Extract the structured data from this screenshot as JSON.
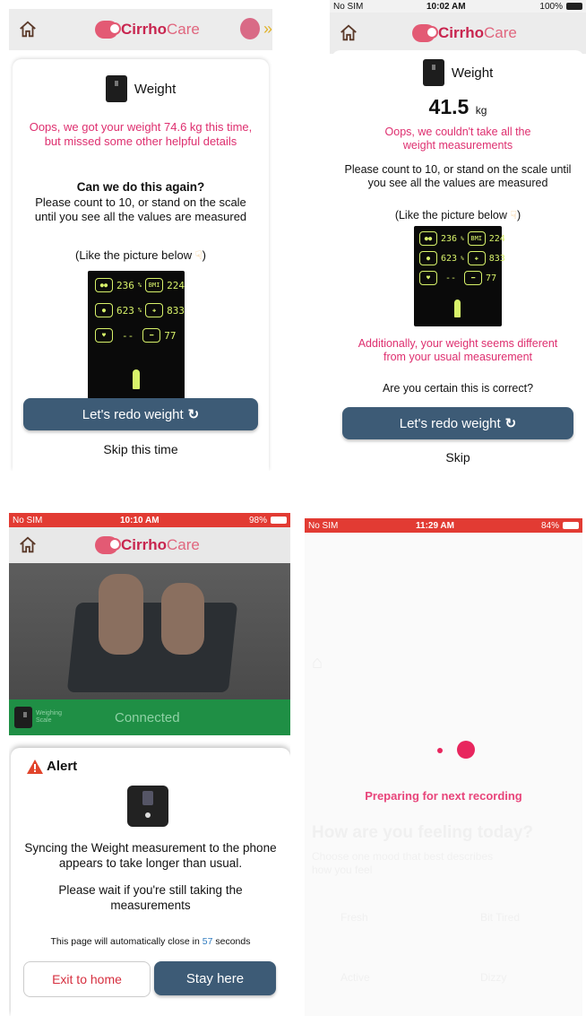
{
  "panel1": {
    "logo_bold": "Cirrho",
    "logo_light": "Care",
    "title": "Weight",
    "warning": "Oops, we got your weight 74.6 kg this time, but missed some other helpful details",
    "question": "Can we do this again?",
    "instruction": "Please count to 10, or stand on the scale until you see all the values are measured",
    "picture_hint": "(Like the picture below",
    "picture_hint_end": ")",
    "display": {
      "r1a": "236",
      "r1a_unit": "%",
      "r1b": "224",
      "r2a": "623",
      "r2a_unit": "%",
      "r2b": "833",
      "r3a": "--",
      "r3b": "77",
      "bmi": "BMI"
    },
    "redo_button": "Let's redo weight",
    "skip_button": "Skip this time"
  },
  "panel2": {
    "status": {
      "carrier": "No SIM",
      "time": "10:02 AM",
      "battery": "100%"
    },
    "logo_bold": "Cirrho",
    "logo_light": "Care",
    "title": "Weight",
    "value": "41.5",
    "unit": "kg",
    "warning": "Oops, we couldn't take all the weight measurements",
    "instruction": "Please count to 10, or stand on the scale until you see all the values are measured",
    "picture_hint": "(Like the picture below",
    "picture_hint_end": ")",
    "display": {
      "r1a": "236",
      "r1a_unit": "%",
      "r1b": "224",
      "r2a": "623",
      "r2a_unit": "%",
      "r2b": "833",
      "r3a": "--",
      "r3b": "77",
      "bmi": "BMI"
    },
    "extra_warning": "Additionally, your weight seems different from your usual measurement",
    "confirm_question": "Are you certain this is correct?",
    "redo_button": "Let's redo weight",
    "skip_button": "Skip"
  },
  "panel3": {
    "status": {
      "carrier": "No SIM",
      "time": "10:10 AM",
      "battery": "98%"
    },
    "logo_bold": "Cirrho",
    "logo_light": "Care",
    "device_label_line1": "Weighing",
    "device_label_line2": "Scale",
    "connected": "Connected",
    "alert_title": "Alert",
    "message": "Syncing the Weight measurement to the phone appears to take longer than usual.",
    "wait_message": "Please wait if you're still taking the measurements",
    "countdown_prefix": "This page will automatically close in",
    "countdown_value": "57",
    "countdown_suffix": "seconds",
    "exit_button": "Exit to home",
    "stay_button": "Stay here",
    "colors": {
      "connected_bg": "#1f8f45",
      "status_red": "#e23b33"
    }
  },
  "panel4": {
    "status": {
      "carrier": "No SIM",
      "time": "11:29 AM",
      "battery": "84%"
    },
    "preparing": "Preparing for next recording",
    "bg_title": "How are you feeling today?",
    "bg_sub": "Choose one mood that best describes how you feel",
    "bg_options": [
      "Fresh",
      "Bit Tired",
      "Active",
      "Dizzy"
    ]
  }
}
